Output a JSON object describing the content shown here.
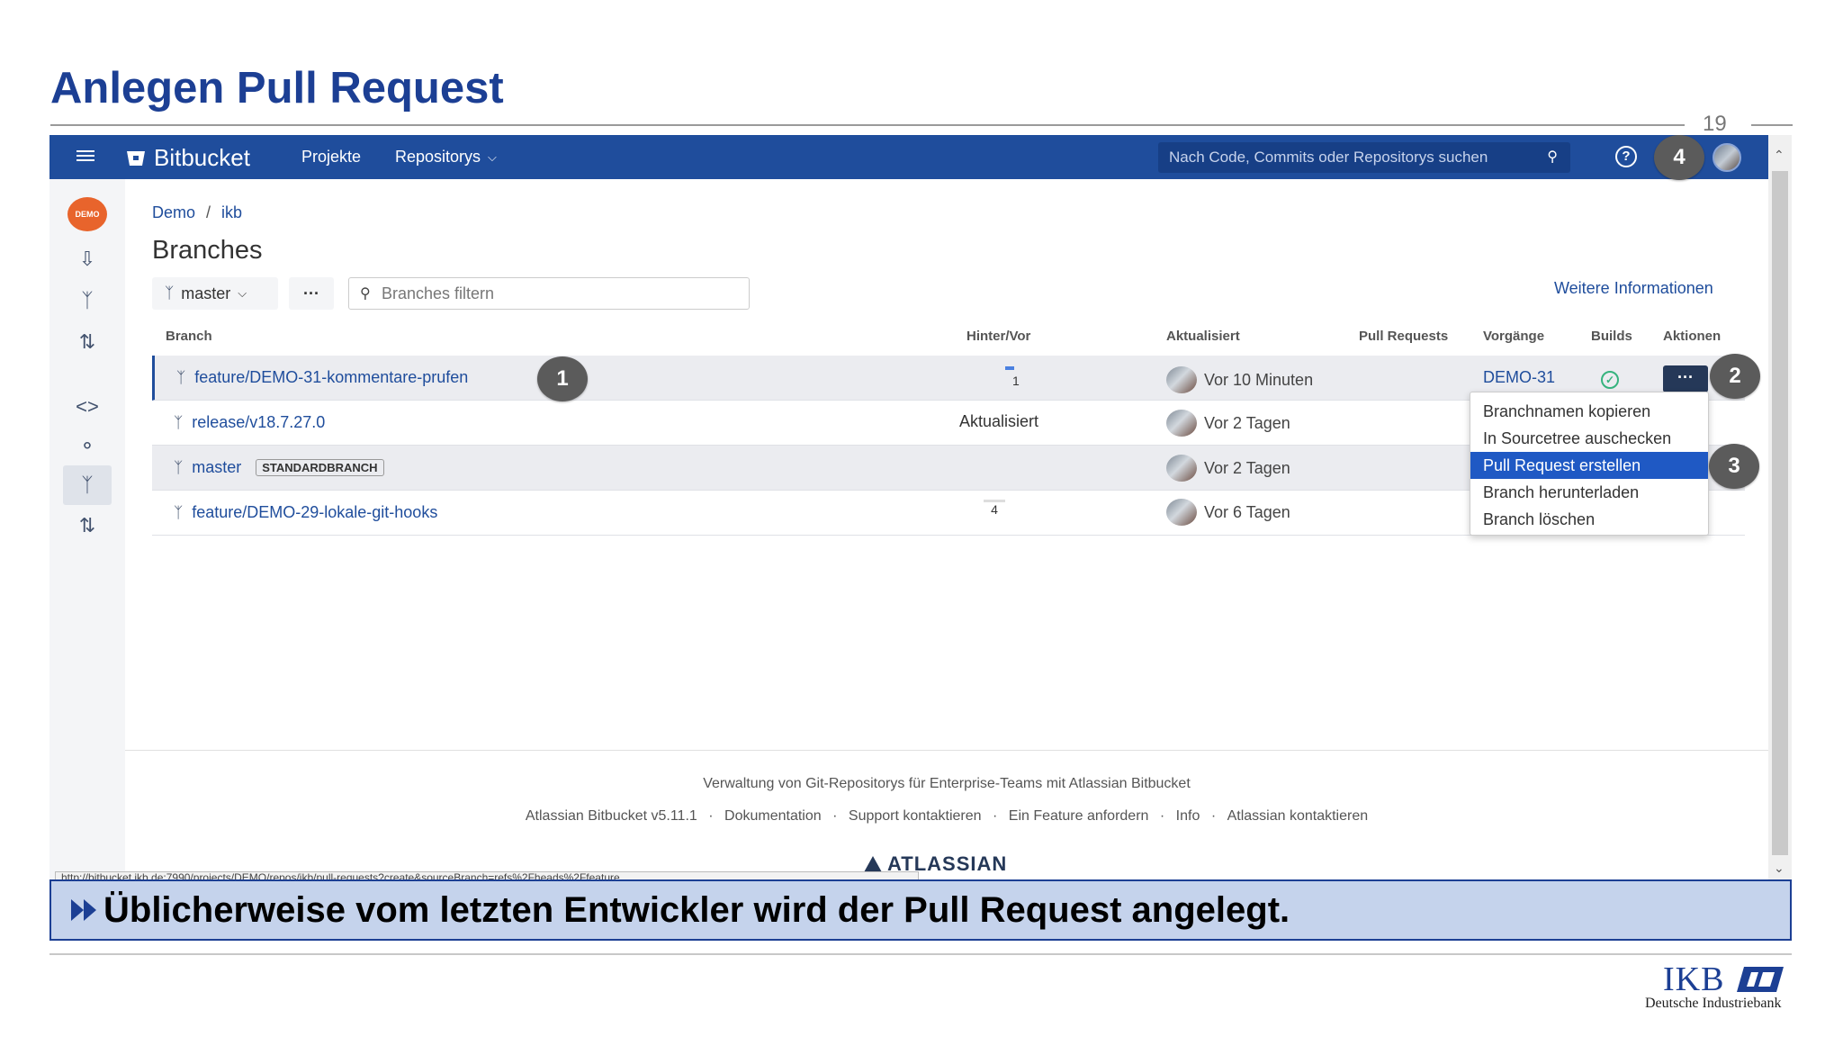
{
  "slide": {
    "title": "Anlegen Pull Request",
    "page_number": "19",
    "banner_text": "Üblicherweise vom letzten Entwickler wird der Pull Request angelegt."
  },
  "topbar": {
    "app_name": "Bitbucket",
    "nav_projects": "Projekte",
    "nav_repositories": "Repositorys",
    "search_placeholder": "Nach Code, Commits oder Repositorys suchen",
    "bar_color": "#1f4d9c"
  },
  "callouts": {
    "c1": "1",
    "c2": "2",
    "c3": "3",
    "c4": "4"
  },
  "sidebar": {
    "project_avatar_text": "DEMO",
    "icons": [
      "create-branch-icon",
      "branches-icon",
      "pull-requests-icon",
      "source-icon",
      "commits-icon",
      "branches-icon-active",
      "pull-requests-icon"
    ]
  },
  "breadcrumb": {
    "project": "Demo",
    "separator": "/",
    "repo": "ikb"
  },
  "page": {
    "heading": "Branches",
    "branch_selector": "master",
    "more_label": "···",
    "filter_placeholder": "Branches filtern",
    "more_info_link": "Weitere Informationen"
  },
  "table": {
    "headers": {
      "branch": "Branch",
      "behind_ahead": "Hinter/Vor",
      "updated": "Aktualisiert",
      "pull_requests": "Pull Requests",
      "issues": "Vorgänge",
      "builds": "Builds",
      "actions": "Aktionen"
    },
    "rows": [
      {
        "name": "feature/DEMO-31-kommentare-prufen",
        "ahead": "1",
        "updated": "Vor 10 Minuten",
        "issue": "DEMO-31",
        "build": "success"
      },
      {
        "name": "release/v18.7.27.0",
        "status": "Aktualisiert",
        "updated": "Vor 2 Tagen"
      },
      {
        "name": "master",
        "badge": "STANDARDBRANCH",
        "updated": "Vor 2 Tagen"
      },
      {
        "name": "feature/DEMO-29-lokale-git-hooks",
        "behind": "4",
        "updated": "Vor 6 Tagen"
      }
    ],
    "actions_label": "···"
  },
  "dropdown": {
    "items": [
      "Branchnamen kopieren",
      "In Sourcetree auschecken",
      "Pull Request erstellen",
      "Branch herunterladen",
      "Branch löschen"
    ],
    "highlighted_index": 2
  },
  "footer": {
    "tagline": "Verwaltung von Git-Repositorys für Enterprise-Teams mit Atlassian Bitbucket",
    "links": [
      "Atlassian Bitbucket v5.11.1",
      "Dokumentation",
      "Support kontaktieren",
      "Ein Feature anfordern",
      "Info",
      "Atlassian kontaktieren"
    ],
    "link_separator": "·",
    "brand": "ATLASSIAN"
  },
  "status_url": "http://bitbucket.ikb.de:7990/projects/DEMO/repos/ikb/pull-requests?create&sourceBranch=refs%2Fheads%2Ffeature",
  "ikb": {
    "wordmark": "IKB",
    "subtitle": "Deutsche Industriebank"
  }
}
